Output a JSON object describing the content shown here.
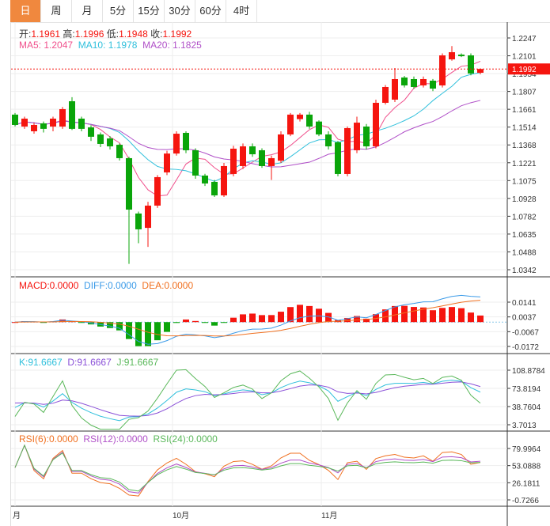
{
  "tabs": [
    "日",
    "周",
    "月",
    "5分",
    "15分",
    "30分",
    "60分",
    "4时"
  ],
  "active_tab": 0,
  "ohlc": {
    "open_label": "开:",
    "open": "1.1961",
    "high_label": "高:",
    "high": "1.1996",
    "low_label": "低:",
    "low": "1.1948",
    "close_label": "收:",
    "close": "1.1992"
  },
  "ma": {
    "ma5": "MA5: 1.2047",
    "ma10": "MA10: 1.1978",
    "ma20": "MA20: 1.1825"
  },
  "macd": {
    "macd": "MACD:0.0000",
    "diff": "DIFF:0.0000",
    "dea": "DEA:0.0000",
    "ticks": [
      "0.0141",
      "0.0037",
      "-0.0067",
      "-0.0172"
    ]
  },
  "kdj": {
    "k": "K:91.6667",
    "d": "D:91.6667",
    "j": "J:91.6667",
    "ticks": [
      "108.8784",
      "73.8194",
      "38.7604",
      "3.7013"
    ]
  },
  "rsi": {
    "r6": "RSI(6):0.0000",
    "r12": "RSI(12):0.0000",
    "r24": "RSI(24):0.0000",
    "ticks": [
      "79.9964",
      "53.0888",
      "26.1811",
      "-0.7266"
    ]
  },
  "price_ticks": [
    "1.2247",
    "1.2101",
    "1.1954",
    "1.1807",
    "1.1661",
    "1.1514",
    "1.1368",
    "1.1221",
    "1.1075",
    "1.0928",
    "1.0782",
    "1.0635",
    "1.0488",
    "1.0342"
  ],
  "current_price": "1.1992",
  "x_labels": [
    "月",
    "10月",
    "11月"
  ],
  "colors": {
    "up": "#f5150f",
    "down": "#0aa50a",
    "ma5": "#f0508c",
    "ma10": "#30c0dc",
    "ma20": "#b050c8",
    "diff": "#3a9ae8",
    "dea": "#f07020",
    "k": "#30c0dc",
    "d": "#8a50d8",
    "j": "#5ab85a",
    "rsi6": "#f07020",
    "rsi12": "#b050c8",
    "rsi24": "#5ab85a",
    "tab_active": "#f0883e"
  },
  "chart_data": {
    "type": "candlestick",
    "columns": [
      "open",
      "high",
      "low",
      "close"
    ],
    "candles": [
      [
        1.1617,
        1.163,
        1.152,
        1.1532
      ],
      [
        1.1519,
        1.16,
        1.15,
        1.1584
      ],
      [
        1.148,
        1.155,
        1.146,
        1.1532
      ],
      [
        1.1545,
        1.156,
        1.147,
        1.15
      ],
      [
        1.1519,
        1.16,
        1.148,
        1.1584
      ],
      [
        1.1519,
        1.168,
        1.15,
        1.1662
      ],
      [
        1.1727,
        1.176,
        1.149,
        1.15
      ],
      [
        1.1584,
        1.16,
        1.148,
        1.15
      ],
      [
        1.1512,
        1.153,
        1.14,
        1.1435
      ],
      [
        1.1454,
        1.147,
        1.135,
        1.1376
      ],
      [
        1.1421,
        1.144,
        1.133,
        1.1356
      ],
      [
        1.1369,
        1.138,
        1.124,
        1.1259
      ],
      [
        1.1259,
        1.127,
        1.039,
        1.0836
      ],
      [
        1.0804,
        1.082,
        1.056,
        1.0674
      ],
      [
        1.0686,
        1.09,
        1.053,
        1.0869
      ],
      [
        1.0869,
        1.112,
        1.085,
        1.1103
      ],
      [
        1.1142,
        1.132,
        1.112,
        1.1297
      ],
      [
        1.1297,
        1.148,
        1.128,
        1.146
      ],
      [
        1.1467,
        1.148,
        1.13,
        1.1324
      ],
      [
        1.1324,
        1.134,
        1.109,
        1.1116
      ],
      [
        1.1116,
        1.113,
        1.103,
        1.1051
      ],
      [
        1.1064,
        1.108,
        1.094,
        1.0953
      ],
      [
        1.0953,
        1.122,
        1.094,
        1.1194
      ],
      [
        1.1129,
        1.136,
        1.111,
        1.1337
      ],
      [
        1.1194,
        1.138,
        1.117,
        1.1356
      ],
      [
        1.1356,
        1.138,
        1.127,
        1.1291
      ],
      [
        1.1324,
        1.134,
        1.118,
        1.1194
      ],
      [
        1.1194,
        1.128,
        1.108,
        1.1259
      ],
      [
        1.1238,
        1.148,
        1.122,
        1.1454
      ],
      [
        1.1454,
        1.163,
        1.144,
        1.1617
      ],
      [
        1.158,
        1.163,
        1.156,
        1.1617
      ],
      [
        1.1617,
        1.164,
        1.15,
        1.1519
      ],
      [
        1.156,
        1.157,
        1.144,
        1.1454
      ],
      [
        1.1454,
        1.148,
        1.133,
        1.1356
      ],
      [
        1.1389,
        1.14,
        1.111,
        1.1129
      ],
      [
        1.1129,
        1.152,
        1.111,
        1.1506
      ],
      [
        1.1324,
        1.16,
        1.13,
        1.1551
      ],
      [
        1.1519,
        1.154,
        1.133,
        1.1356
      ],
      [
        1.1356,
        1.174,
        1.134,
        1.1714
      ],
      [
        1.1714,
        1.186,
        1.17,
        1.1844
      ],
      [
        1.174,
        1.2,
        1.172,
        1.1909
      ],
      [
        1.1922,
        1.1935,
        1.184,
        1.1857
      ],
      [
        1.1909,
        1.193,
        1.183,
        1.1844
      ],
      [
        1.1857,
        1.193,
        1.184,
        1.1909
      ],
      [
        1.1896,
        1.191,
        1.181,
        1.1831
      ],
      [
        1.1857,
        1.212,
        1.184,
        1.2104
      ],
      [
        1.2071,
        1.218,
        1.206,
        1.213
      ],
      [
        1.211,
        1.212,
        1.209,
        1.2097
      ],
      [
        1.2104,
        1.212,
        1.194,
        1.1955
      ],
      [
        1.1961,
        1.1996,
        1.1948,
        1.1992
      ]
    ],
    "price_range": [
      1.0342,
      1.2247
    ],
    "grid": true
  }
}
